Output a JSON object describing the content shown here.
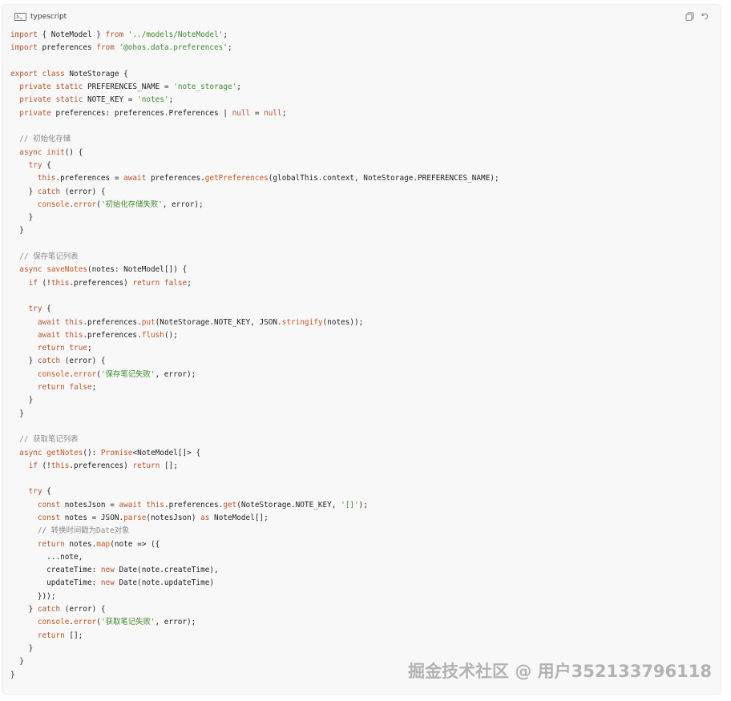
{
  "header": {
    "language_label": "typescript",
    "terminal_icon": "terminal-icon",
    "copy_icon": "copy-icon",
    "wrap_icon": "wrap-toggle-icon"
  },
  "code": {
    "lines": [
      [
        {
          "t": "import",
          "c": "kw"
        },
        {
          "t": " { NoteModel } "
        },
        {
          "t": "from",
          "c": "kw"
        },
        {
          "t": " "
        },
        {
          "t": "'../models/NoteModel'",
          "c": "str"
        },
        {
          "t": ";"
        }
      ],
      [
        {
          "t": "import",
          "c": "kw"
        },
        {
          "t": " preferences "
        },
        {
          "t": "from",
          "c": "kw"
        },
        {
          "t": " "
        },
        {
          "t": "'@ohos.data.preferences'",
          "c": "str"
        },
        {
          "t": ";"
        }
      ],
      [],
      [
        {
          "t": "export",
          "c": "kw"
        },
        {
          "t": " "
        },
        {
          "t": "class",
          "c": "kw"
        },
        {
          "t": " NoteStorage {"
        }
      ],
      [
        {
          "t": "  "
        },
        {
          "t": "private",
          "c": "kw"
        },
        {
          "t": " "
        },
        {
          "t": "static",
          "c": "kw"
        },
        {
          "t": " PREFERENCES_NAME = "
        },
        {
          "t": "'note_storage'",
          "c": "str"
        },
        {
          "t": ";"
        }
      ],
      [
        {
          "t": "  "
        },
        {
          "t": "private",
          "c": "kw"
        },
        {
          "t": " "
        },
        {
          "t": "static",
          "c": "kw"
        },
        {
          "t": " NOTE_KEY = "
        },
        {
          "t": "'notes'",
          "c": "str"
        },
        {
          "t": ";"
        }
      ],
      [
        {
          "t": "  "
        },
        {
          "t": "private",
          "c": "kw"
        },
        {
          "t": " preferences: preferences.Preferences | "
        },
        {
          "t": "null",
          "c": "kw"
        },
        {
          "t": " = "
        },
        {
          "t": "null",
          "c": "kw"
        },
        {
          "t": ";"
        }
      ],
      [],
      [
        {
          "t": "  // 初始化存储",
          "c": "cmt"
        }
      ],
      [
        {
          "t": "  "
        },
        {
          "t": "async",
          "c": "kw"
        },
        {
          "t": " "
        },
        {
          "t": "init",
          "c": "fn"
        },
        {
          "t": "() {"
        }
      ],
      [
        {
          "t": "    "
        },
        {
          "t": "try",
          "c": "kw"
        },
        {
          "t": " {"
        }
      ],
      [
        {
          "t": "      "
        },
        {
          "t": "this",
          "c": "kw"
        },
        {
          "t": ".preferences = "
        },
        {
          "t": "await",
          "c": "kw"
        },
        {
          "t": " preferences."
        },
        {
          "t": "getPreferences",
          "c": "fn"
        },
        {
          "t": "(globalThis.context, NoteStorage.PREFERENCES_NAME);"
        }
      ],
      [
        {
          "t": "    } "
        },
        {
          "t": "catch",
          "c": "kw"
        },
        {
          "t": " (error) {"
        }
      ],
      [
        {
          "t": "      "
        },
        {
          "t": "console",
          "c": "fn"
        },
        {
          "t": "."
        },
        {
          "t": "error",
          "c": "fn"
        },
        {
          "t": "("
        },
        {
          "t": "'初始化存储失败'",
          "c": "str"
        },
        {
          "t": ", error);"
        }
      ],
      [
        {
          "t": "    }"
        }
      ],
      [
        {
          "t": "  }"
        }
      ],
      [],
      [
        {
          "t": "  // 保存笔记列表",
          "c": "cmt"
        }
      ],
      [
        {
          "t": "  "
        },
        {
          "t": "async",
          "c": "kw"
        },
        {
          "t": " "
        },
        {
          "t": "saveNotes",
          "c": "fn"
        },
        {
          "t": "(notes: NoteModel[]) {"
        }
      ],
      [
        {
          "t": "    "
        },
        {
          "t": "if",
          "c": "kw"
        },
        {
          "t": " (!"
        },
        {
          "t": "this",
          "c": "kw"
        },
        {
          "t": ".preferences) "
        },
        {
          "t": "return",
          "c": "kw"
        },
        {
          "t": " "
        },
        {
          "t": "false",
          "c": "kw"
        },
        {
          "t": ";"
        }
      ],
      [],
      [
        {
          "t": "    "
        },
        {
          "t": "try",
          "c": "kw"
        },
        {
          "t": " {"
        }
      ],
      [
        {
          "t": "      "
        },
        {
          "t": "await",
          "c": "kw"
        },
        {
          "t": " "
        },
        {
          "t": "this",
          "c": "kw"
        },
        {
          "t": ".preferences."
        },
        {
          "t": "put",
          "c": "fn"
        },
        {
          "t": "(NoteStorage.NOTE_KEY, JSON."
        },
        {
          "t": "stringify",
          "c": "fn"
        },
        {
          "t": "(notes));"
        }
      ],
      [
        {
          "t": "      "
        },
        {
          "t": "await",
          "c": "kw"
        },
        {
          "t": " "
        },
        {
          "t": "this",
          "c": "kw"
        },
        {
          "t": ".preferences."
        },
        {
          "t": "flush",
          "c": "fn"
        },
        {
          "t": "();"
        }
      ],
      [
        {
          "t": "      "
        },
        {
          "t": "return",
          "c": "kw"
        },
        {
          "t": " "
        },
        {
          "t": "true",
          "c": "kw"
        },
        {
          "t": ";"
        }
      ],
      [
        {
          "t": "    } "
        },
        {
          "t": "catch",
          "c": "kw"
        },
        {
          "t": " (error) {"
        }
      ],
      [
        {
          "t": "      "
        },
        {
          "t": "console",
          "c": "fn"
        },
        {
          "t": "."
        },
        {
          "t": "error",
          "c": "fn"
        },
        {
          "t": "("
        },
        {
          "t": "'保存笔记失败'",
          "c": "str"
        },
        {
          "t": ", error);"
        }
      ],
      [
        {
          "t": "      "
        },
        {
          "t": "return",
          "c": "kw"
        },
        {
          "t": " "
        },
        {
          "t": "false",
          "c": "kw"
        },
        {
          "t": ";"
        }
      ],
      [
        {
          "t": "    }"
        }
      ],
      [
        {
          "t": "  }"
        }
      ],
      [],
      [
        {
          "t": "  // 获取笔记列表",
          "c": "cmt"
        }
      ],
      [
        {
          "t": "  "
        },
        {
          "t": "async",
          "c": "kw"
        },
        {
          "t": " "
        },
        {
          "t": "getNotes",
          "c": "fn"
        },
        {
          "t": "(): "
        },
        {
          "t": "Promise",
          "c": "fn"
        },
        {
          "t": "<NoteModel[]> {"
        }
      ],
      [
        {
          "t": "    "
        },
        {
          "t": "if",
          "c": "kw"
        },
        {
          "t": " (!"
        },
        {
          "t": "this",
          "c": "kw"
        },
        {
          "t": ".preferences) "
        },
        {
          "t": "return",
          "c": "kw"
        },
        {
          "t": " [];"
        }
      ],
      [],
      [
        {
          "t": "    "
        },
        {
          "t": "try",
          "c": "kw"
        },
        {
          "t": " {"
        }
      ],
      [
        {
          "t": "      "
        },
        {
          "t": "const",
          "c": "kw"
        },
        {
          "t": " notesJson = "
        },
        {
          "t": "await",
          "c": "kw"
        },
        {
          "t": " "
        },
        {
          "t": "this",
          "c": "kw"
        },
        {
          "t": ".preferences."
        },
        {
          "t": "get",
          "c": "fn"
        },
        {
          "t": "(NoteStorage.NOTE_KEY, "
        },
        {
          "t": "'[]'",
          "c": "str"
        },
        {
          "t": ");"
        }
      ],
      [
        {
          "t": "      "
        },
        {
          "t": "const",
          "c": "kw"
        },
        {
          "t": " notes = JSON."
        },
        {
          "t": "parse",
          "c": "fn"
        },
        {
          "t": "(notesJson) "
        },
        {
          "t": "as",
          "c": "kw"
        },
        {
          "t": " NoteModel[];"
        }
      ],
      [
        {
          "t": "      // 转换时间戳为Date对象",
          "c": "cmt"
        }
      ],
      [
        {
          "t": "      "
        },
        {
          "t": "return",
          "c": "kw"
        },
        {
          "t": " notes."
        },
        {
          "t": "map",
          "c": "fn"
        },
        {
          "t": "(note => ({"
        }
      ],
      [
        {
          "t": "        ...note,"
        }
      ],
      [
        {
          "t": "        createTime: "
        },
        {
          "t": "new",
          "c": "kw"
        },
        {
          "t": " Date(note.createTime),"
        }
      ],
      [
        {
          "t": "        updateTime: "
        },
        {
          "t": "new",
          "c": "kw"
        },
        {
          "t": " Date(note.updateTime)"
        }
      ],
      [
        {
          "t": "      }));"
        }
      ],
      [
        {
          "t": "    } "
        },
        {
          "t": "catch",
          "c": "kw"
        },
        {
          "t": " (error) {"
        }
      ],
      [
        {
          "t": "      "
        },
        {
          "t": "console",
          "c": "fn"
        },
        {
          "t": "."
        },
        {
          "t": "error",
          "c": "fn"
        },
        {
          "t": "("
        },
        {
          "t": "'获取笔记失败'",
          "c": "str"
        },
        {
          "t": ", error);"
        }
      ],
      [
        {
          "t": "      "
        },
        {
          "t": "return",
          "c": "kw"
        },
        {
          "t": " [];"
        }
      ],
      [
        {
          "t": "    }"
        }
      ],
      [
        {
          "t": "  }"
        }
      ],
      [
        {
          "t": "}"
        }
      ]
    ]
  },
  "watermark": "掘金技术社区 @ 用户352133796118",
  "colors": {
    "keyword": "#b5542a",
    "string": "#3d8a2a",
    "comment": "#8a8a8a",
    "function": "#c4561f",
    "text": "#1f1f1f",
    "background": "#f8f8f9"
  }
}
